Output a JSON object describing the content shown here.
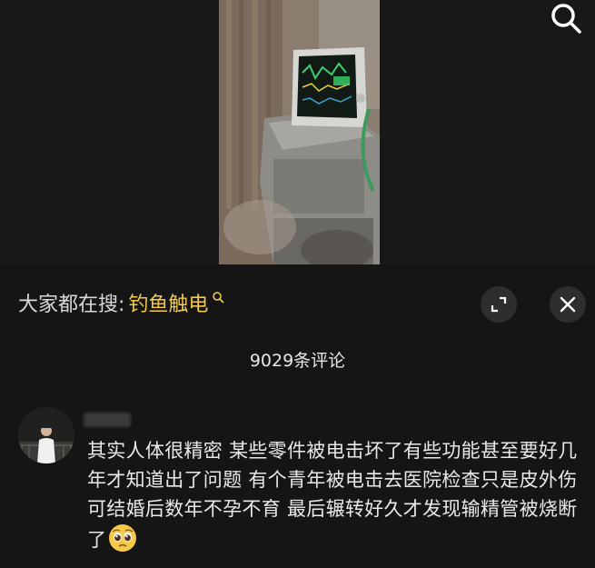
{
  "video": {
    "description_icon": "video-thumbnail"
  },
  "search_suggestion": {
    "prefix": "大家都在搜:",
    "keyword": "钓鱼触电"
  },
  "comment_count": "9029条评论",
  "comments": [
    {
      "text": "其实人体很精密 某些零件被电击坏了有些功能甚至要好几年才知道出了问题 有个青年被电击去医院检查只是皮外伤 可结婚后数年不孕不育 最后辗转好久才发现输精管被烧断了",
      "emoji": "pleading-face-emoji"
    }
  ],
  "colors": {
    "background": "#151515",
    "keyword": "#f2c94c",
    "button_bg": "#2e2e2e"
  }
}
